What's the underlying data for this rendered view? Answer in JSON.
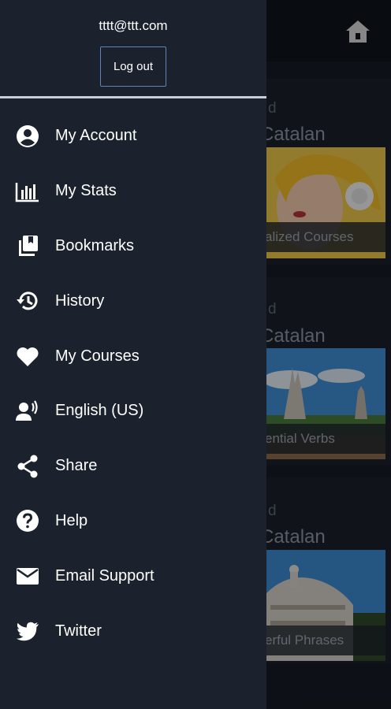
{
  "drawer": {
    "email": "tttt@ttt.com",
    "logout_label": "Log out",
    "items": [
      {
        "label": "My Account",
        "icon": "account-circle-icon"
      },
      {
        "label": "My Stats",
        "icon": "stats-chart-icon"
      },
      {
        "label": "Bookmarks",
        "icon": "bookmarks-icon"
      },
      {
        "label": "History",
        "icon": "history-icon"
      },
      {
        "label": "My Courses",
        "icon": "heart-icon"
      },
      {
        "label": "English (US)",
        "icon": "voice-language-icon"
      },
      {
        "label": "Share",
        "icon": "share-icon"
      },
      {
        "label": "Help",
        "icon": "help-icon"
      },
      {
        "label": "Email Support",
        "icon": "email-icon"
      },
      {
        "label": "Twitter",
        "icon": "twitter-icon"
      }
    ]
  },
  "background": {
    "home_icon": "home-icon",
    "cards": [
      {
        "small": "d",
        "title": "Catalan",
        "caption": "alized Courses"
      },
      {
        "small": "d",
        "title": "Catalan",
        "caption": "ential Verbs"
      },
      {
        "small": "d",
        "title": "Catalan",
        "caption": "erful Phrases"
      }
    ]
  },
  "colors": {
    "drawer_bg": "#1b222d",
    "accent_border": "#5d86b8",
    "divider": "#c9ced6",
    "text": "#ffffff"
  }
}
